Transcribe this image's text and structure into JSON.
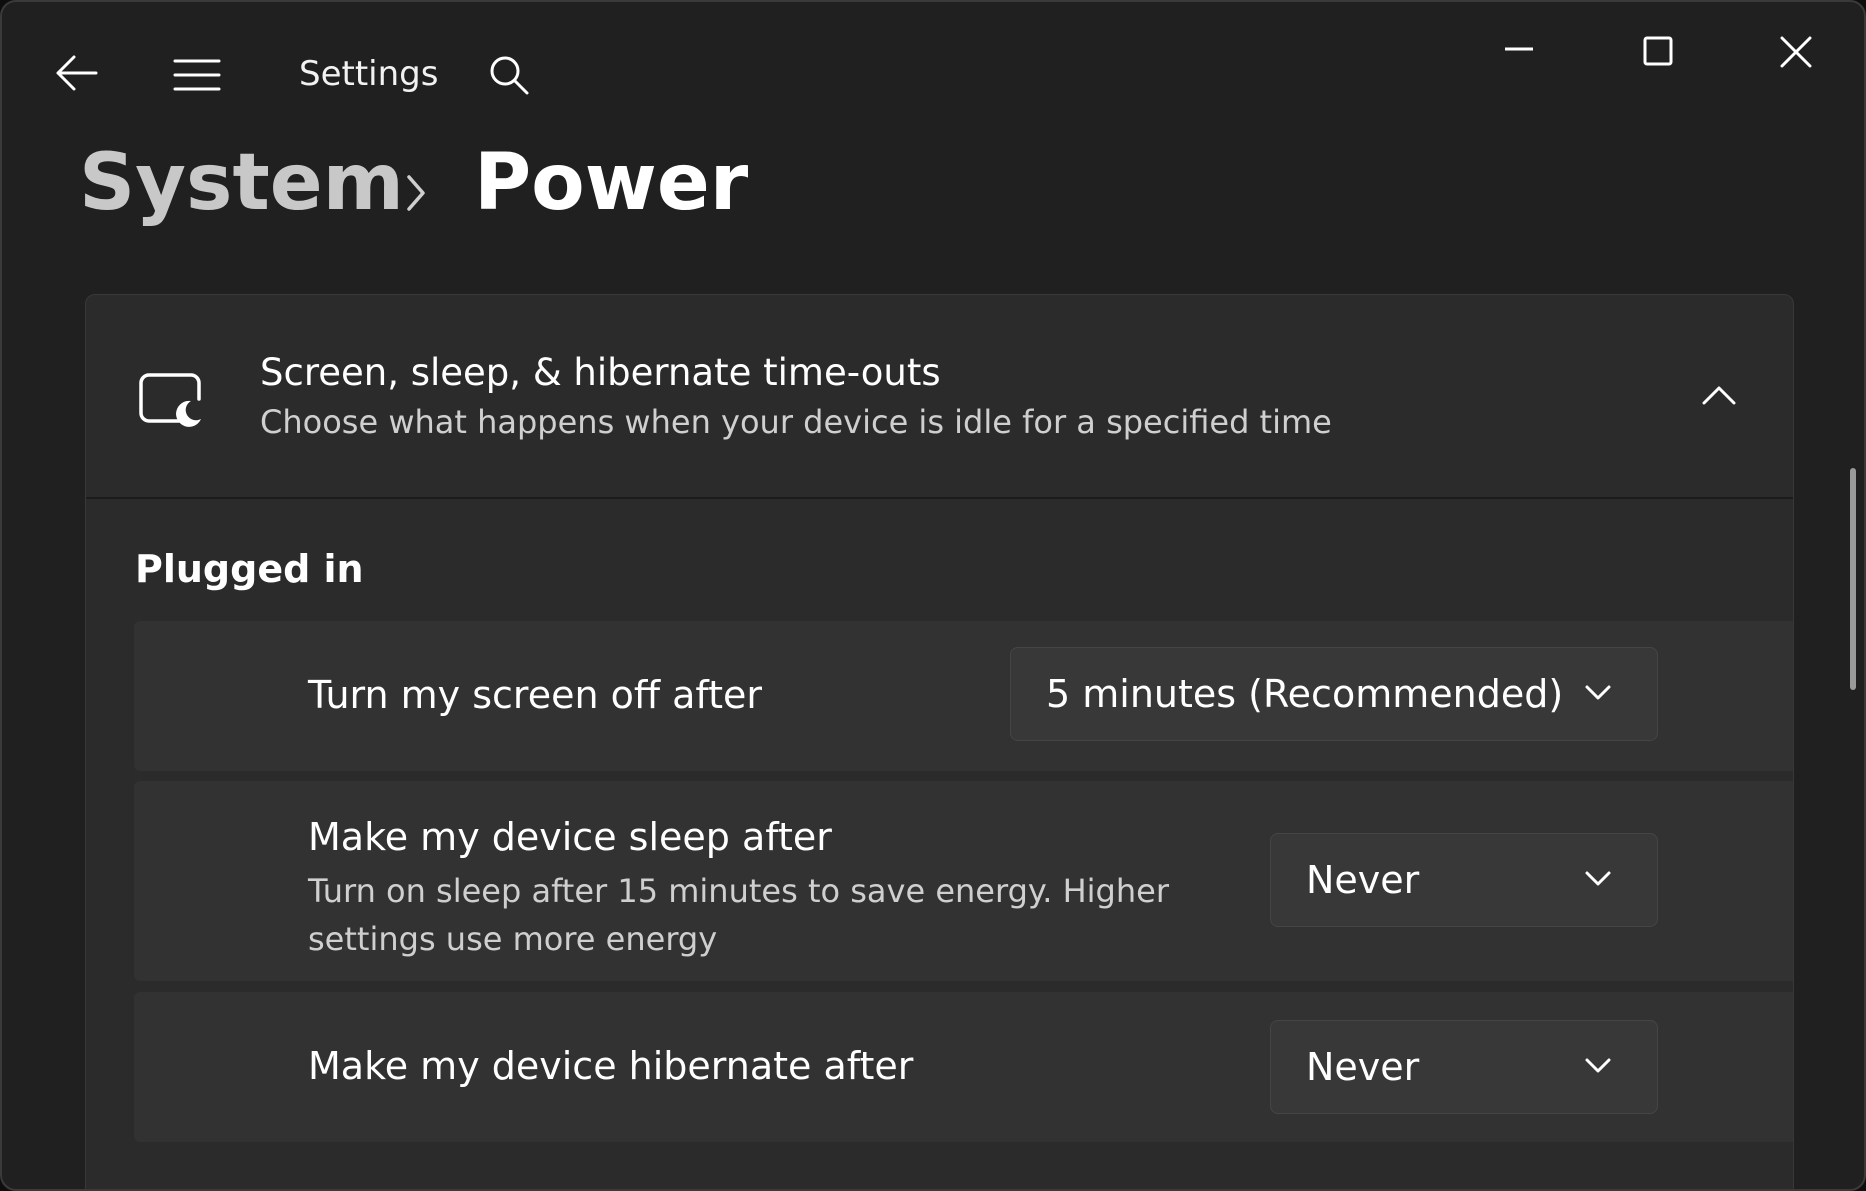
{
  "window": {
    "app_title": "Settings",
    "controls": {
      "minimize_icon": "minimize-icon",
      "maximize_icon": "maximize-icon",
      "close_icon": "close-icon"
    }
  },
  "breadcrumb": {
    "parent": "System",
    "current": "Power"
  },
  "card": {
    "title": "Screen, sleep, & hibernate time-outs",
    "subtitle": "Choose what happens when your device is idle for a specified time",
    "icon": "screen-sleep-icon",
    "expanded": true
  },
  "section": {
    "label": "Plugged in"
  },
  "settings": [
    {
      "label": "Turn my screen off after",
      "value": "5 minutes (Recommended)"
    },
    {
      "label": "Make my device sleep after",
      "description": "Turn on sleep after 15 minutes to save energy. Higher settings use more energy",
      "value": "Never"
    },
    {
      "label": "Make my device hibernate after",
      "value": "Never"
    }
  ],
  "colors": {
    "window_bg": "#202020",
    "card_bg": "#2b2b2b",
    "row_bg": "#323232",
    "dropdown_bg": "#383838"
  }
}
